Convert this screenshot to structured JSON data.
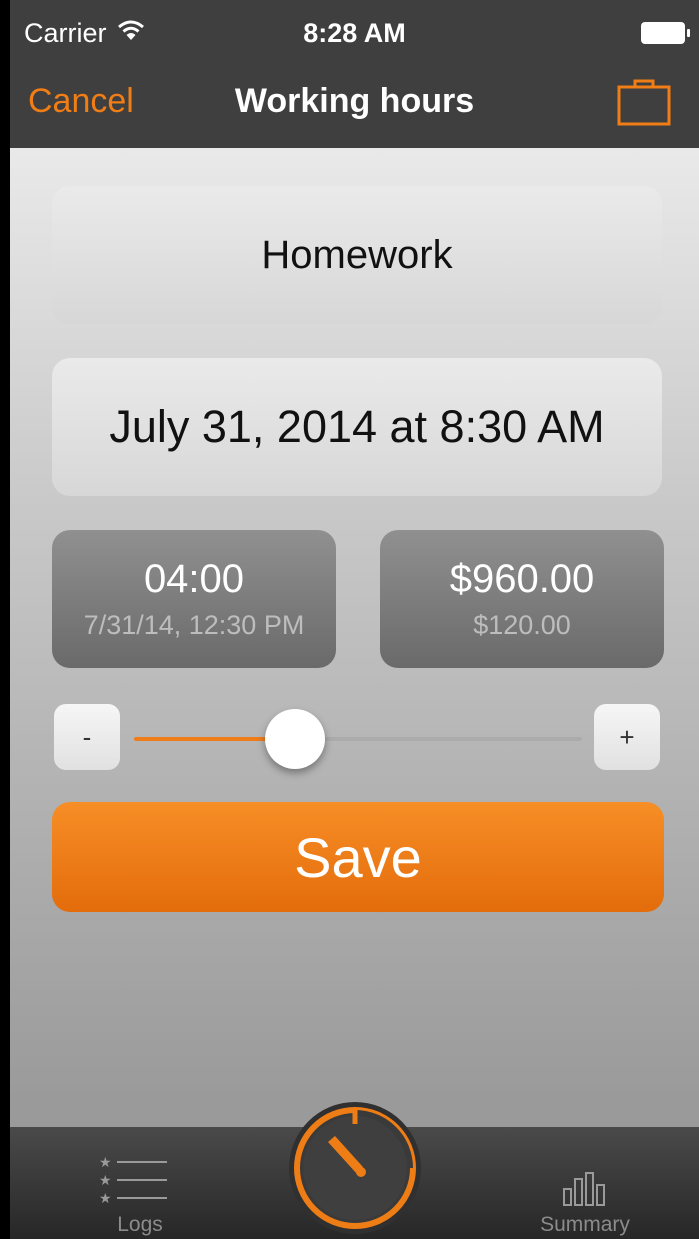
{
  "status_bar": {
    "carrier": "Carrier",
    "time": "8:28 AM"
  },
  "nav": {
    "cancel_label": "Cancel",
    "title": "Working hours"
  },
  "form": {
    "project": "Homework",
    "start_datetime": "July 31, 2014 at 8:30 AM",
    "duration": "04:00",
    "end_datetime": "7/31/14, 12:30 PM",
    "total_amount": "$960.00",
    "hourly_rate": "$120.00"
  },
  "slider": {
    "minus_label": "-",
    "plus_label": "+",
    "value_fraction": 0.36
  },
  "save_label": "Save",
  "tabs": {
    "logs_label": "Logs",
    "summary_label": "Summary"
  },
  "colors": {
    "accent": "#f07d16",
    "nav_bg": "#3f3f3f"
  }
}
